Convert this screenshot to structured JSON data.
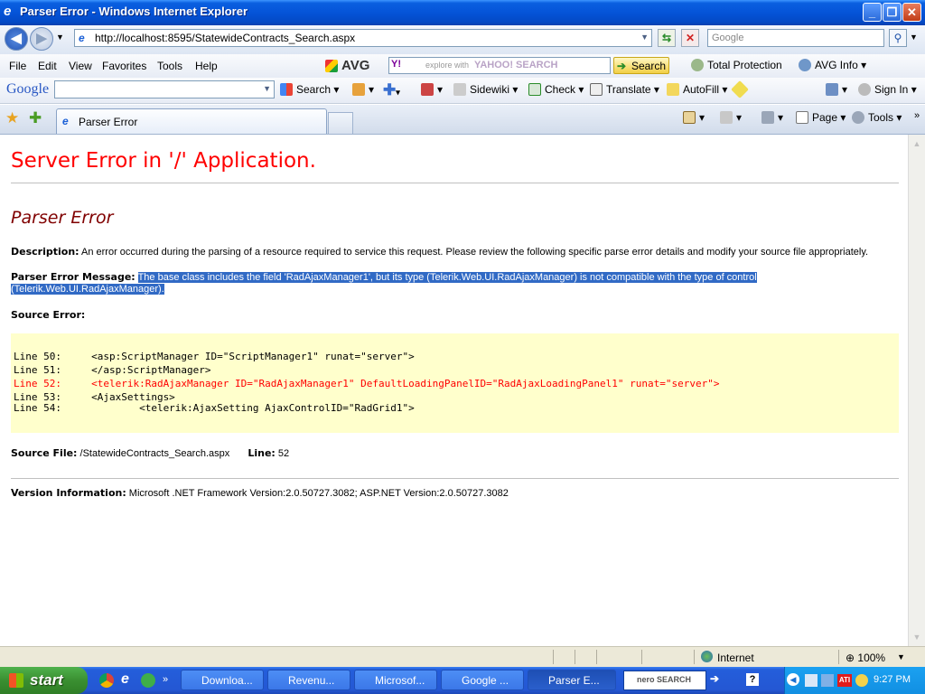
{
  "window": {
    "title": "Parser Error - Windows Internet Explorer"
  },
  "address": {
    "url": "http://localhost:8595/StatewideContracts_Search.aspx",
    "search_placeholder": "Google"
  },
  "menu": [
    "File",
    "Edit",
    "View",
    "Favorites",
    "Tools",
    "Help"
  ],
  "avg_toolbar": {
    "brand": "AVG",
    "search_placeholder": "explore with",
    "yahoo_label": "YAHOO! SEARCH",
    "search_button": "Search",
    "total_protection": "Total Protection",
    "avg_info": "AVG Info"
  },
  "google_toolbar": {
    "brand": "Google",
    "search": "Search",
    "sidewiki": "Sidewiki",
    "check": "Check",
    "translate": "Translate",
    "autofill": "AutoFill",
    "sign_in": "Sign In"
  },
  "tabs": {
    "active_tab": "Parser Error"
  },
  "command_bar": {
    "page": "Page",
    "tools": "Tools"
  },
  "page": {
    "heading": "Server Error in '/' Application.",
    "subheading": "Parser Error",
    "description_label": "Description:",
    "description_text": "An error occurred during the parsing of a resource required to service this request. Please review the following specific parse error details and modify your source file appropriately.",
    "message_label": "Parser Error Message:",
    "message_line1": "The base class includes the field 'RadAjaxManager1', but its type (Telerik.Web.UI.RadAjaxManager) is not compatible with the type of control",
    "message_line2": "(Telerik.Web.UI.RadAjaxManager).",
    "source_error_label": "Source Error:",
    "code_lines": [
      "Line 50:     <asp:ScriptManager ID=\"ScriptManager1\" runat=\"server\">",
      "Line 51:     </asp:ScriptManager>",
      "Line 52:     <telerik:RadAjaxManager ID=\"RadAjaxManager1\" DefaultLoadingPanelID=\"RadAjaxLoadingPanel1\" runat=\"server\">",
      "Line 53:     <AjaxSettings>",
      "Line 54:             <telerik:AjaxSetting AjaxControlID=\"RadGrid1\">"
    ],
    "source_file_label": "Source File:",
    "source_file_value": "/StatewideContracts_Search.aspx",
    "line_label": "Line:",
    "line_value": "52",
    "version_label": "Version Information:",
    "version_value": "Microsoft .NET Framework Version:2.0.50727.3082; ASP.NET Version:2.0.50727.3082"
  },
  "status_bar": {
    "zone": "Internet",
    "zoom": "100%"
  },
  "taskbar": {
    "start": "start",
    "buttons": [
      "Downloa...",
      "Revenu...",
      "Microsof...",
      "Google ...",
      "Parser E..."
    ],
    "nero_label": "nero SEARCH",
    "clock": "9:27 PM"
  },
  "colors": {
    "error_red": "#ff0000",
    "maroon": "#800000",
    "code_bg": "#ffffcc",
    "selection": "#316ac5"
  }
}
